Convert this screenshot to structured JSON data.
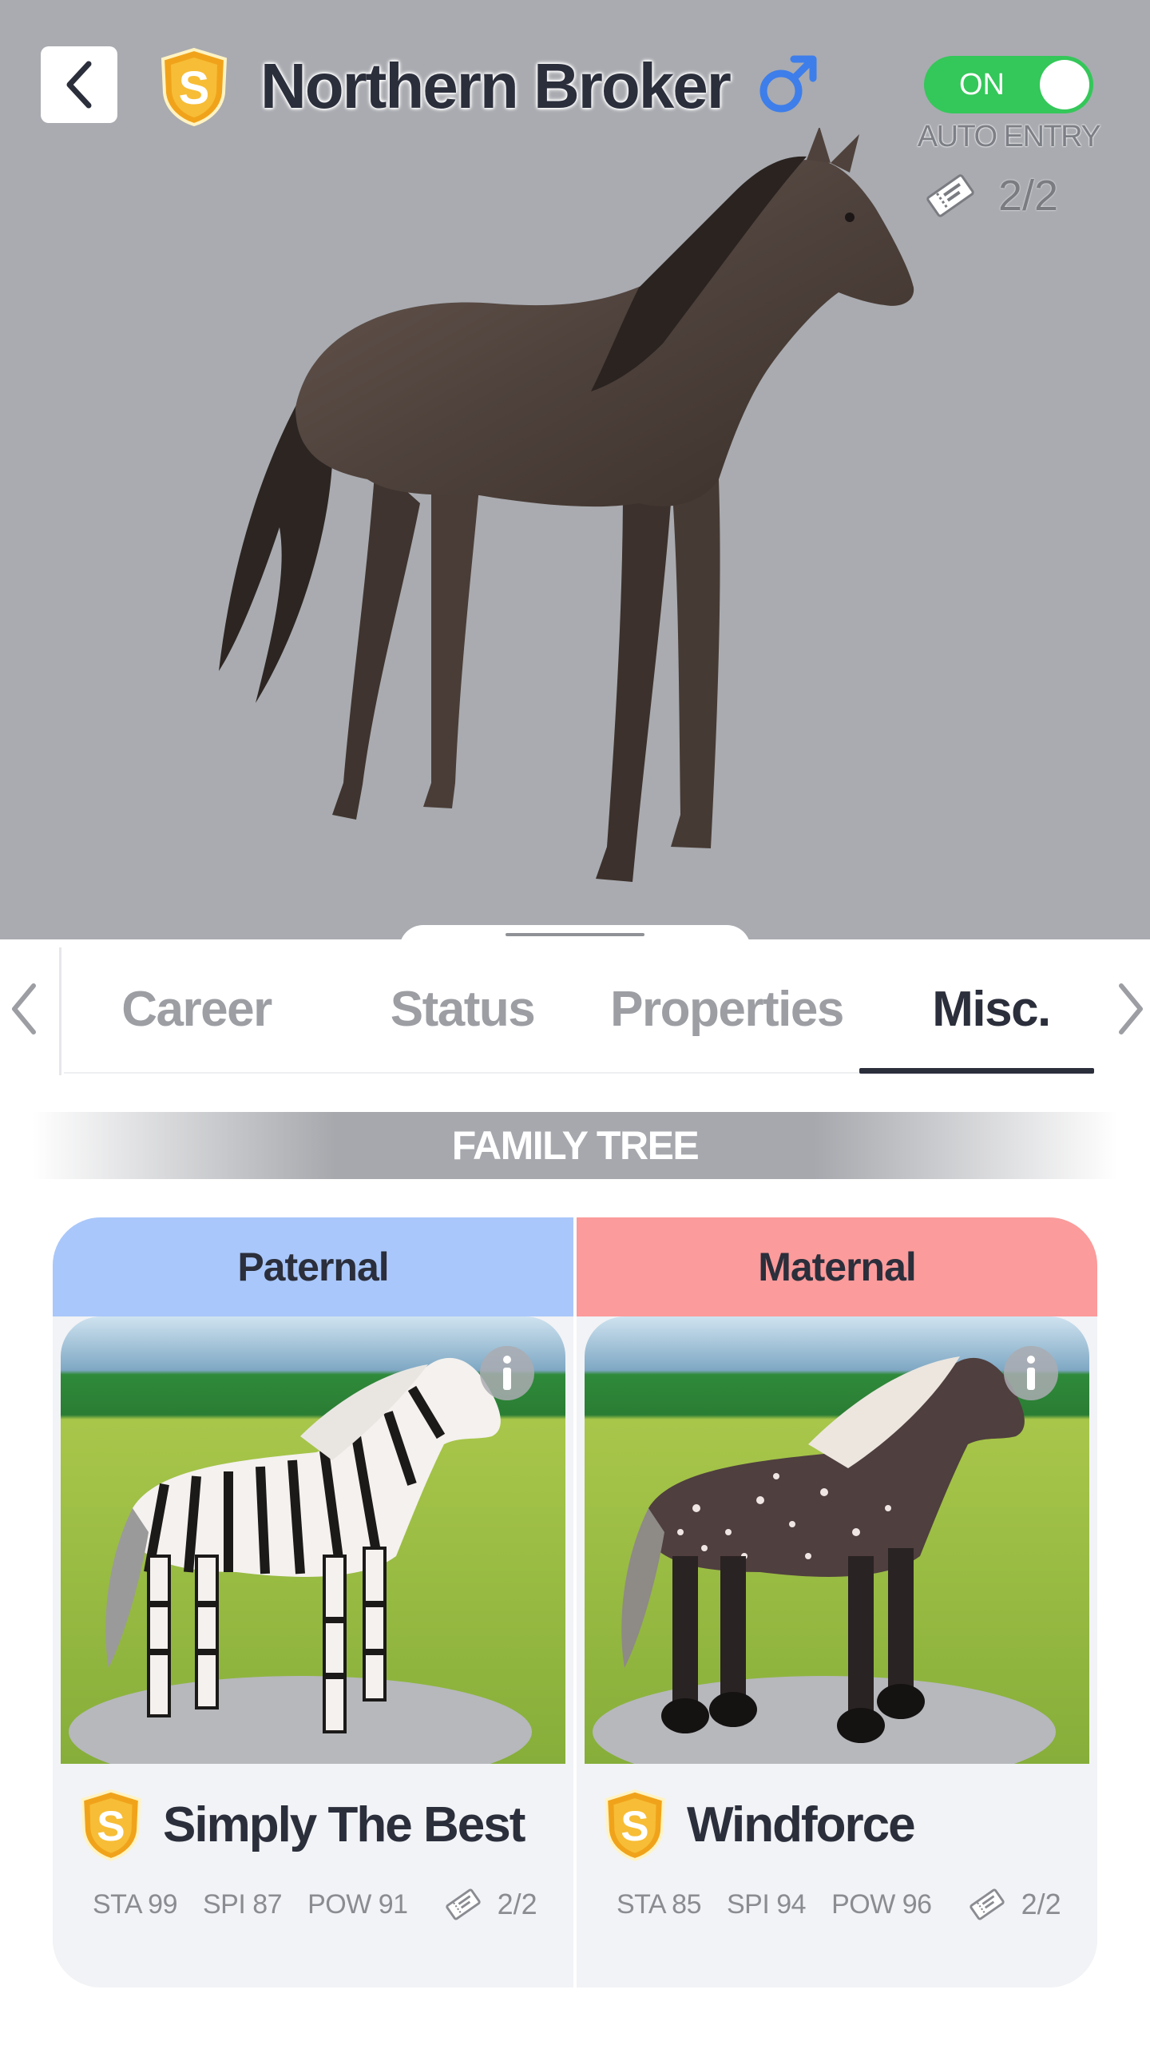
{
  "header": {
    "rank": "S",
    "horse_name": "Northern Broker",
    "gender_symbol": "♂",
    "auto_entry": {
      "toggle_label": "ON",
      "is_on": true,
      "label": "AUTO ENTRY",
      "ticket_count": "2/2"
    }
  },
  "tabs": {
    "items": [
      {
        "label": "Career",
        "active": false
      },
      {
        "label": "Status",
        "active": false
      },
      {
        "label": "Properties",
        "active": false
      },
      {
        "label": "Misc.",
        "active": true
      }
    ]
  },
  "family_tree": {
    "title": "FAMILY TREE",
    "paternal": {
      "heading": "Paternal",
      "rank": "S",
      "name": "Simply The Best",
      "stats": {
        "sta": "STA 99",
        "spi": "SPI 87",
        "pow": "POW 91",
        "tickets": "2/2"
      }
    },
    "maternal": {
      "heading": "Maternal",
      "rank": "S",
      "name": "Windforce",
      "stats": {
        "sta": "STA 85",
        "spi": "SPI 94",
        "pow": "POW 96",
        "tickets": "2/2"
      }
    }
  },
  "colors": {
    "hero_bg": "#a9abb0",
    "toggle_on": "#34c759",
    "paternal_header": "#a9c7fa",
    "maternal_header": "#fb9b9b",
    "text_dark": "#2b2e3b",
    "gender_blue": "#3d7eea"
  }
}
